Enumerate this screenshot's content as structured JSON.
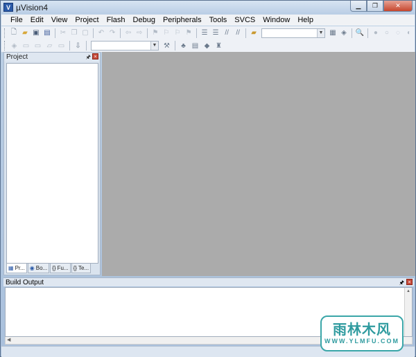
{
  "window": {
    "title": "µVision4",
    "controls": [
      "minimize",
      "maximize",
      "close"
    ]
  },
  "menubar": {
    "items": [
      "File",
      "Edit",
      "View",
      "Project",
      "Flash",
      "Debug",
      "Peripherals",
      "Tools",
      "SVCS",
      "Window",
      "Help"
    ]
  },
  "toolbar1": {
    "icons": [
      "new-file-icon",
      "open-file-icon",
      "save-icon",
      "save-all-icon",
      "cut-icon",
      "copy-icon",
      "paste-icon",
      "undo-icon",
      "redo-icon",
      "nav-back-icon",
      "nav-forward-icon",
      "bookmark-icon",
      "prev-bookmark-icon",
      "next-bookmark-icon",
      "clear-bookmarks-icon",
      "indent-icon",
      "unindent-icon",
      "comment-icon",
      "uncomment-icon",
      "find-in-files-icon",
      "find-combo",
      "find-icon",
      "incremental-find-icon",
      "debug-session-icon",
      "breakpoint-icon",
      "disable-breakpoint-icon",
      "kill-breakpoints-icon",
      "more-icon"
    ]
  },
  "toolbar2": {
    "target_select": ""
  },
  "project_pane": {
    "title": "Project",
    "tabs": [
      {
        "label": "Pr...",
        "icon": "project-tab-icon"
      },
      {
        "label": "Bo...",
        "icon": "books-tab-icon"
      },
      {
        "label": "Fu...",
        "icon": "functions-tab-icon"
      },
      {
        "label": "Te...",
        "icon": "templates-tab-icon"
      }
    ]
  },
  "build_output": {
    "title": "Build Output"
  },
  "watermark": {
    "title": "雨林木风",
    "url": "WWW.YLMFU.COM"
  }
}
